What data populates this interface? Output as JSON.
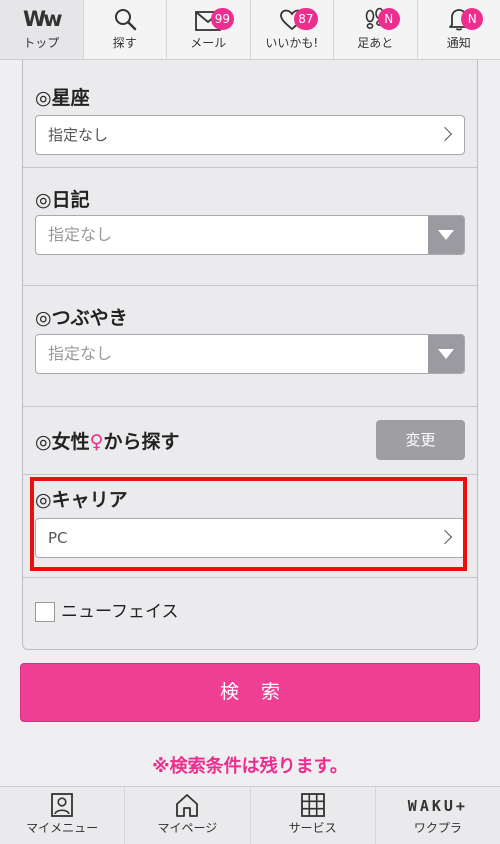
{
  "top_nav": {
    "logo_text": "Ww",
    "items": [
      {
        "label": "トップ",
        "icon": "logo-icon"
      },
      {
        "label": "探す",
        "icon": "search-icon"
      },
      {
        "label": "メール",
        "icon": "mail-icon",
        "badge": "99"
      },
      {
        "label": "いいかも!",
        "icon": "heart-icon",
        "badge": "87"
      },
      {
        "label": "足あと",
        "icon": "footprints-icon",
        "badge": "N"
      },
      {
        "label": "通知",
        "icon": "bell-icon",
        "badge": "N"
      }
    ]
  },
  "form": {
    "zodiac": {
      "title": "◎星座",
      "value": "指定なし"
    },
    "diary": {
      "title": "◎日記",
      "value": "指定なし"
    },
    "tweet": {
      "title": "◎つぶやき",
      "value": "指定なし"
    },
    "female_search": {
      "title_prefix": "◎女性",
      "title_mark": "♀",
      "title_suffix": "から探す",
      "button_label": "変更"
    },
    "carrier": {
      "title": "◎キャリア",
      "value": "PC"
    },
    "new_face": {
      "label": "ニューフェイス",
      "checked": false
    }
  },
  "search_button_label": "検索",
  "note": "※検索条件は残ります。",
  "bottom_nav": {
    "waku_logo": "WAKU+",
    "items": [
      {
        "label": "マイメニュー",
        "icon": "person-icon"
      },
      {
        "label": "マイページ",
        "icon": "home-icon"
      },
      {
        "label": "サービス",
        "icon": "grid-icon"
      },
      {
        "label": "ワクプラ",
        "icon": "waku-plus-logo"
      }
    ]
  },
  "colors": {
    "accent": "#ee2e8f",
    "highlight": "#f00d0d",
    "search_button": "#ee3f94",
    "dropdown_arrow_bg": "#9a9aa0"
  }
}
